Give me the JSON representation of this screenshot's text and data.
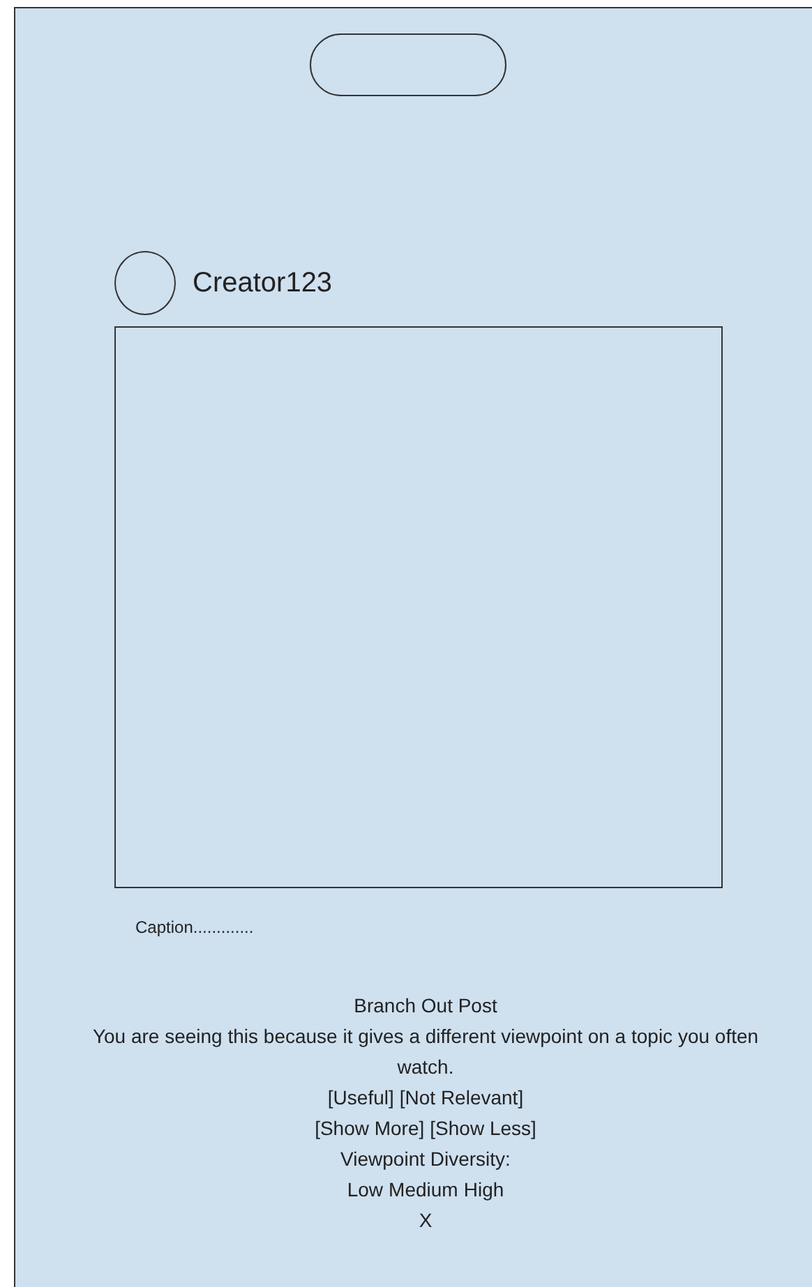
{
  "post": {
    "creator": "Creator123",
    "caption": "Caption............."
  },
  "notice": {
    "title": "Branch Out Post",
    "reason": "You are seeing this because it gives a different viewpoint on a topic you often watch.",
    "feedback_buttons": [
      "[Useful]",
      "[Not Relevant]"
    ],
    "amount_buttons": [
      "[Show More]",
      "[Show Less]"
    ],
    "diversity_label": "Viewpoint Diversity:",
    "diversity_options": [
      "Low",
      "Medium",
      "High"
    ],
    "close": "X"
  }
}
